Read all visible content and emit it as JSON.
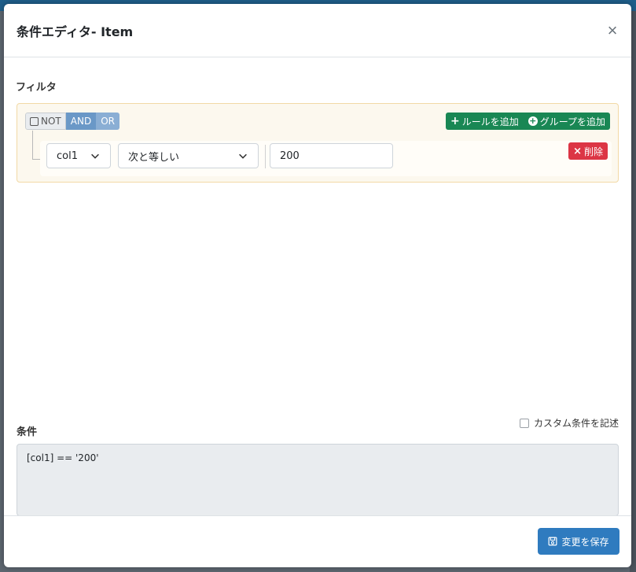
{
  "modal": {
    "title": "条件エディタ- Item",
    "close_glyph": "×"
  },
  "filter": {
    "label": "フィルタ",
    "logic": {
      "not_label": "NOT",
      "and_label": "AND",
      "or_label": "OR",
      "selected": "AND"
    },
    "add_rule_label": "ルールを追加",
    "add_group_label": "グループを追加",
    "rule": {
      "field": "col1",
      "operator": "次と等しい",
      "value": "200",
      "delete_label": "削除"
    }
  },
  "condition": {
    "label": "条件",
    "custom_checkbox_label": "カスタム条件を記述",
    "custom_checked": false,
    "expression": "[col1] == '200'"
  },
  "footer": {
    "save_label": "変更を保存"
  },
  "colors": {
    "primary": "#2f7bbf",
    "success": "#198754",
    "danger": "#dc3545",
    "logic_and": "#6a98c7",
    "builder_bg": "#fcf8ee"
  }
}
